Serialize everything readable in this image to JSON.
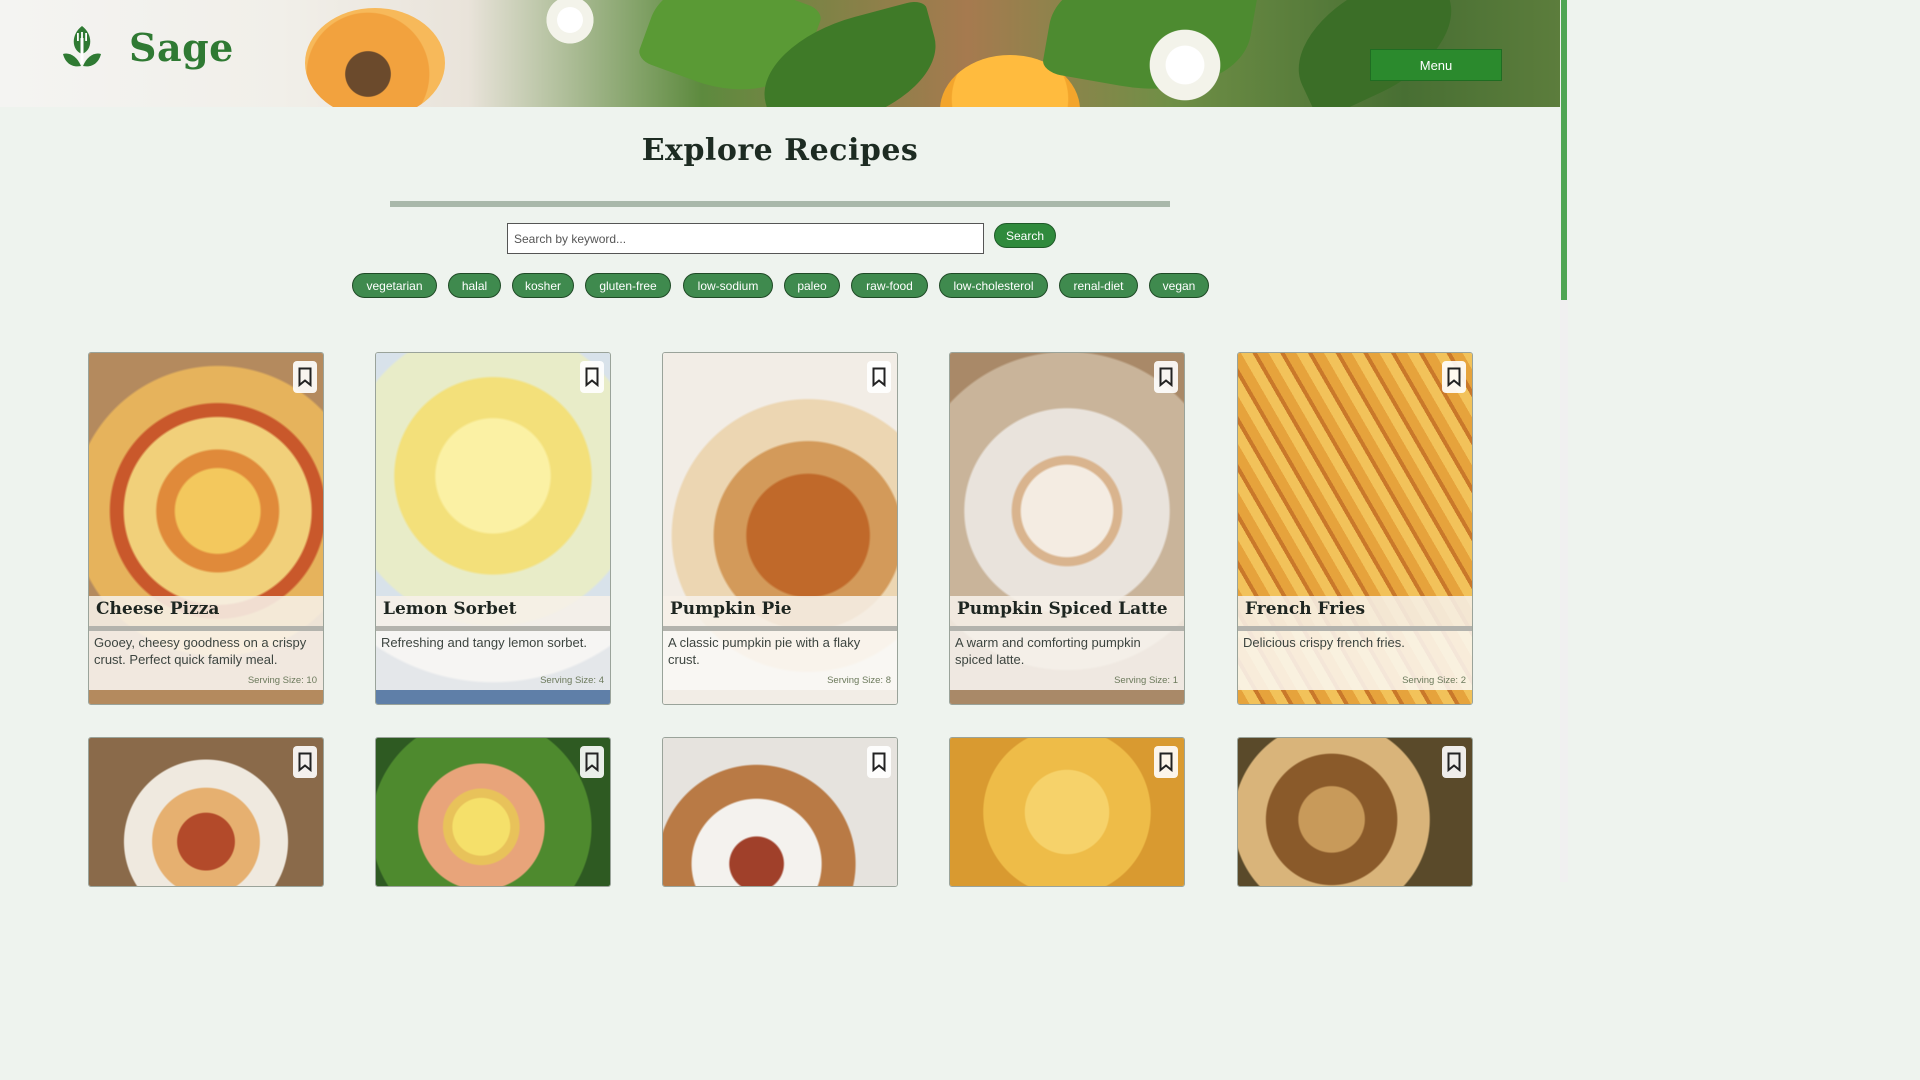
{
  "brand": {
    "name": "Sage"
  },
  "header": {
    "menu_label": "Menu"
  },
  "page": {
    "title": "Explore Recipes"
  },
  "search": {
    "placeholder": "Search by keyword...",
    "value": "",
    "button_label": "Search"
  },
  "tags": [
    "vegetarian",
    "halal",
    "kosher",
    "gluten-free",
    "low-sodium",
    "paleo",
    "raw-food",
    "low-cholesterol",
    "renal-diet",
    "vegan"
  ],
  "recipes": [
    {
      "name": "Cheese Pizza",
      "description": "Gooey, cheesy goodness on a crispy crust. Perfect quick family meal.",
      "serving": "Serving Size: 10"
    },
    {
      "name": "Lemon Sorbet",
      "description": "Refreshing and tangy lemon sorbet.",
      "serving": "Serving Size: 4"
    },
    {
      "name": "Pumpkin Pie",
      "description": "A classic pumpkin pie with a flaky crust.",
      "serving": "Serving Size: 8"
    },
    {
      "name": "Pumpkin Spiced Latte",
      "description": "A warm and comforting pumpkin spiced latte.",
      "serving": "Serving Size: 1"
    },
    {
      "name": "French Fries",
      "description": "Delicious crispy french fries.",
      "serving": "Serving Size: 2"
    }
  ],
  "colors": {
    "accent": "#2b8a2d",
    "tag": "#3f8a4e",
    "background": "#eef3ee",
    "brand_text": "#2f7a33"
  }
}
